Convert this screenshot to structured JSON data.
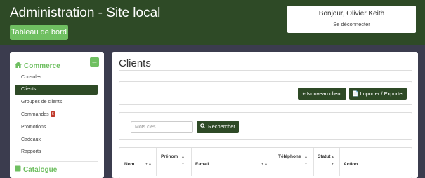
{
  "header": {
    "title": "Administration - Site local",
    "dashboard_label": "Tableau de bord",
    "greeting": "Bonjour, Olivier Keith",
    "logout": "Se déconnecter"
  },
  "sidebar": {
    "collapse_icon": "arrow-left-icon",
    "commerce_title": "Commerce",
    "items": [
      {
        "label": "Consoles"
      },
      {
        "label": "Clients",
        "active": true
      },
      {
        "label": "Groupes de clients"
      },
      {
        "label": "Commandes",
        "badge": "6"
      },
      {
        "label": "Promotions"
      },
      {
        "label": "Cadeaux"
      },
      {
        "label": "Rapports"
      }
    ],
    "catalogue_title": "Catalogue"
  },
  "main": {
    "title": "Clients",
    "new_client": "Nouveau client",
    "import_export": "Importer / Exporter",
    "search_placeholder": "Mots clés",
    "search_button": "Rechercher",
    "columns": [
      "Nom",
      "Prénom",
      "E-mail",
      "Téléphone",
      "Statut",
      "Action"
    ]
  },
  "colors": {
    "brand_dark": "#2e4a26",
    "brand_light": "#6fbf61",
    "badge": "#c0392b"
  }
}
